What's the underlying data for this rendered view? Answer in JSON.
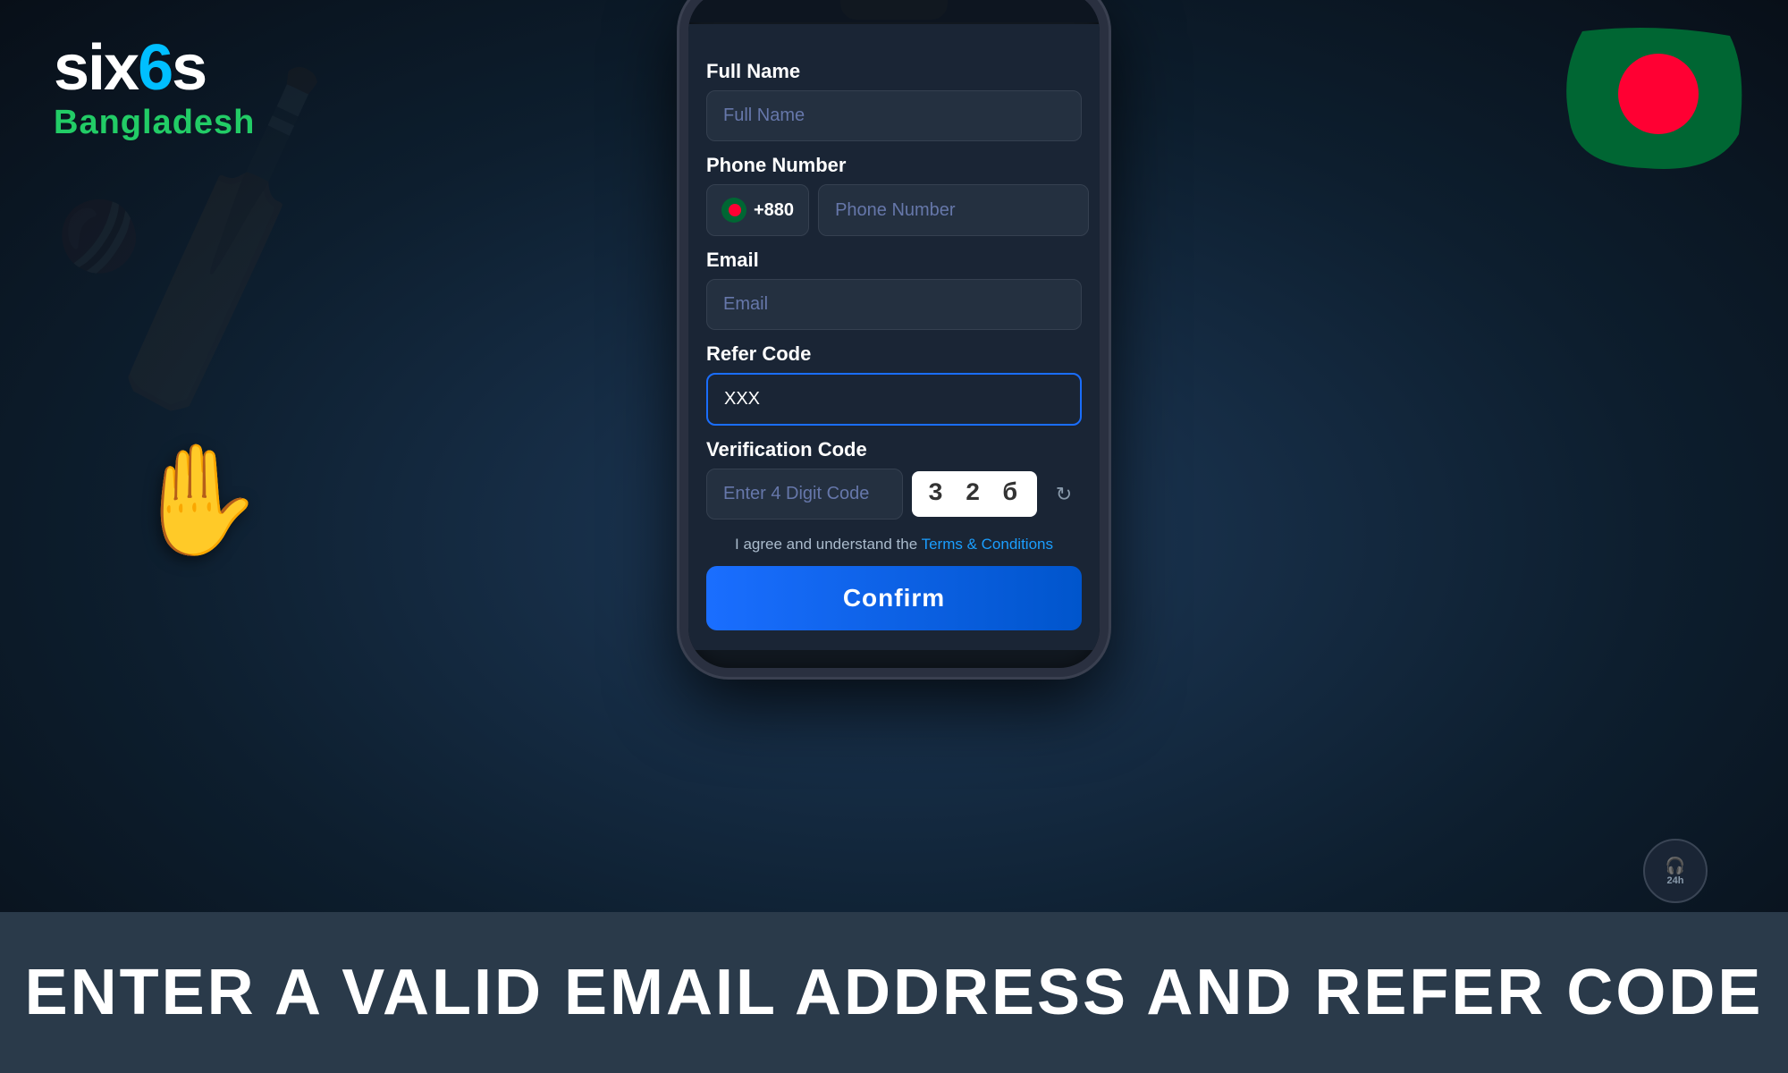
{
  "logo": {
    "main": "six6s",
    "sub": "Bangladesh",
    "part1": "six",
    "part2": "6",
    "part3": "s"
  },
  "flag": {
    "country": "Bangladesh",
    "bg_color": "#006633",
    "circle_color": "#ff0033"
  },
  "form": {
    "full_name_label": "Full Name",
    "full_name_placeholder": "Full Name",
    "phone_label": "Phone Number",
    "phone_prefix": "+880",
    "phone_placeholder": "Phone Number",
    "email_label": "Email",
    "email_placeholder": "Email",
    "refer_label": "Refer Code",
    "refer_value": "XXX",
    "verification_label": "Verification Code",
    "verification_placeholder": "Enter 4 Digit Code",
    "captcha_value": "3 2 б",
    "terms_text": "I agree and understand the ",
    "terms_link": "Terms & Conditions",
    "confirm_label": "Confirm"
  },
  "bottom_banner": {
    "text": "ENTER A VALID EMAIL ADDRESS AND REFER CODE"
  },
  "support": {
    "label": "24h"
  }
}
